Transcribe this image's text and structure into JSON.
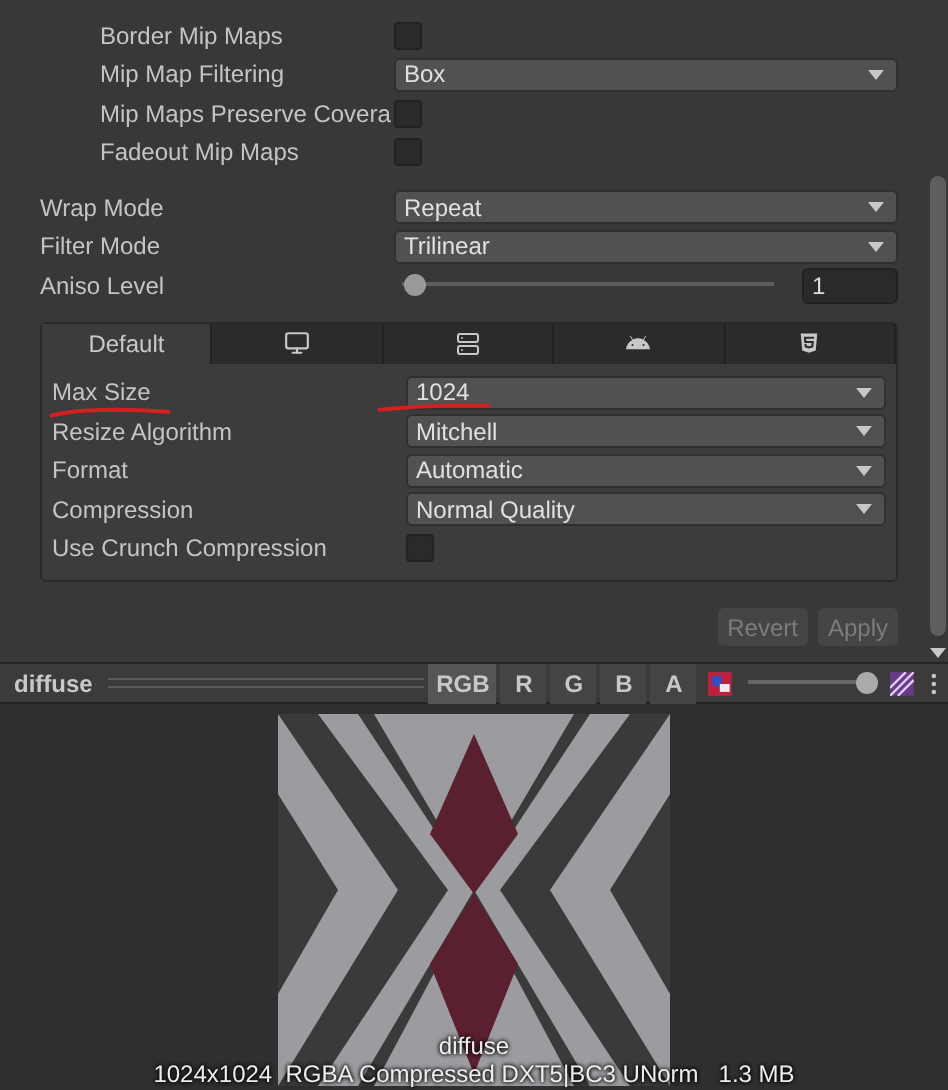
{
  "settings": [
    {
      "kind": "checkbox",
      "label": "Border Mip Maps",
      "indented": true,
      "checked": false
    },
    {
      "kind": "dropdown",
      "label": "Mip Map Filtering",
      "indented": true,
      "value": "Box"
    },
    {
      "kind": "checkbox",
      "label": "Mip Maps Preserve Covera",
      "indented": true,
      "checked": false
    },
    {
      "kind": "checkbox",
      "label": "Fadeout Mip Maps",
      "indented": true,
      "checked": false
    },
    {
      "kind": "gap"
    },
    {
      "kind": "dropdown",
      "label": "Wrap Mode",
      "indented": false,
      "value": "Repeat"
    },
    {
      "kind": "dropdown",
      "label": "Filter Mode",
      "indented": false,
      "value": "Trilinear"
    },
    {
      "kind": "slider",
      "label": "Aniso Level",
      "indented": false,
      "level": 0.03,
      "value": "1"
    }
  ],
  "platform_tabs": [
    {
      "kind": "text",
      "label": "Default",
      "selected": true
    },
    {
      "kind": "monitor",
      "selected": false
    },
    {
      "kind": "server",
      "selected": false
    },
    {
      "kind": "android",
      "selected": false
    },
    {
      "kind": "html5",
      "selected": false
    }
  ],
  "platform_settings": [
    {
      "kind": "dropdown",
      "label": "Max Size",
      "value": "1024",
      "marked": true
    },
    {
      "kind": "dropdown",
      "label": "Resize Algorithm",
      "value": "Mitchell",
      "marked": false
    },
    {
      "kind": "dropdown",
      "label": "Format",
      "value": "Automatic",
      "marked": false
    },
    {
      "kind": "dropdown",
      "label": "Compression",
      "value": "Normal Quality",
      "marked": false
    },
    {
      "kind": "checkbox",
      "label": "Use Crunch Compression",
      "checked": false,
      "marked": false
    }
  ],
  "actions": [
    {
      "label": "Revert",
      "disabled": true
    },
    {
      "label": "Apply",
      "disabled": true
    }
  ],
  "preview": {
    "title": "diffuse",
    "channels": [
      {
        "label": "RGB",
        "selected": true
      },
      {
        "label": "R",
        "selected": false
      },
      {
        "label": "G",
        "selected": false
      },
      {
        "label": "B",
        "selected": false
      },
      {
        "label": "A",
        "selected": false
      }
    ],
    "caption": "diffuse",
    "info": "1024x1024  RGBA Compressed DXT5|BC3 UNorm   1.3 MB"
  }
}
